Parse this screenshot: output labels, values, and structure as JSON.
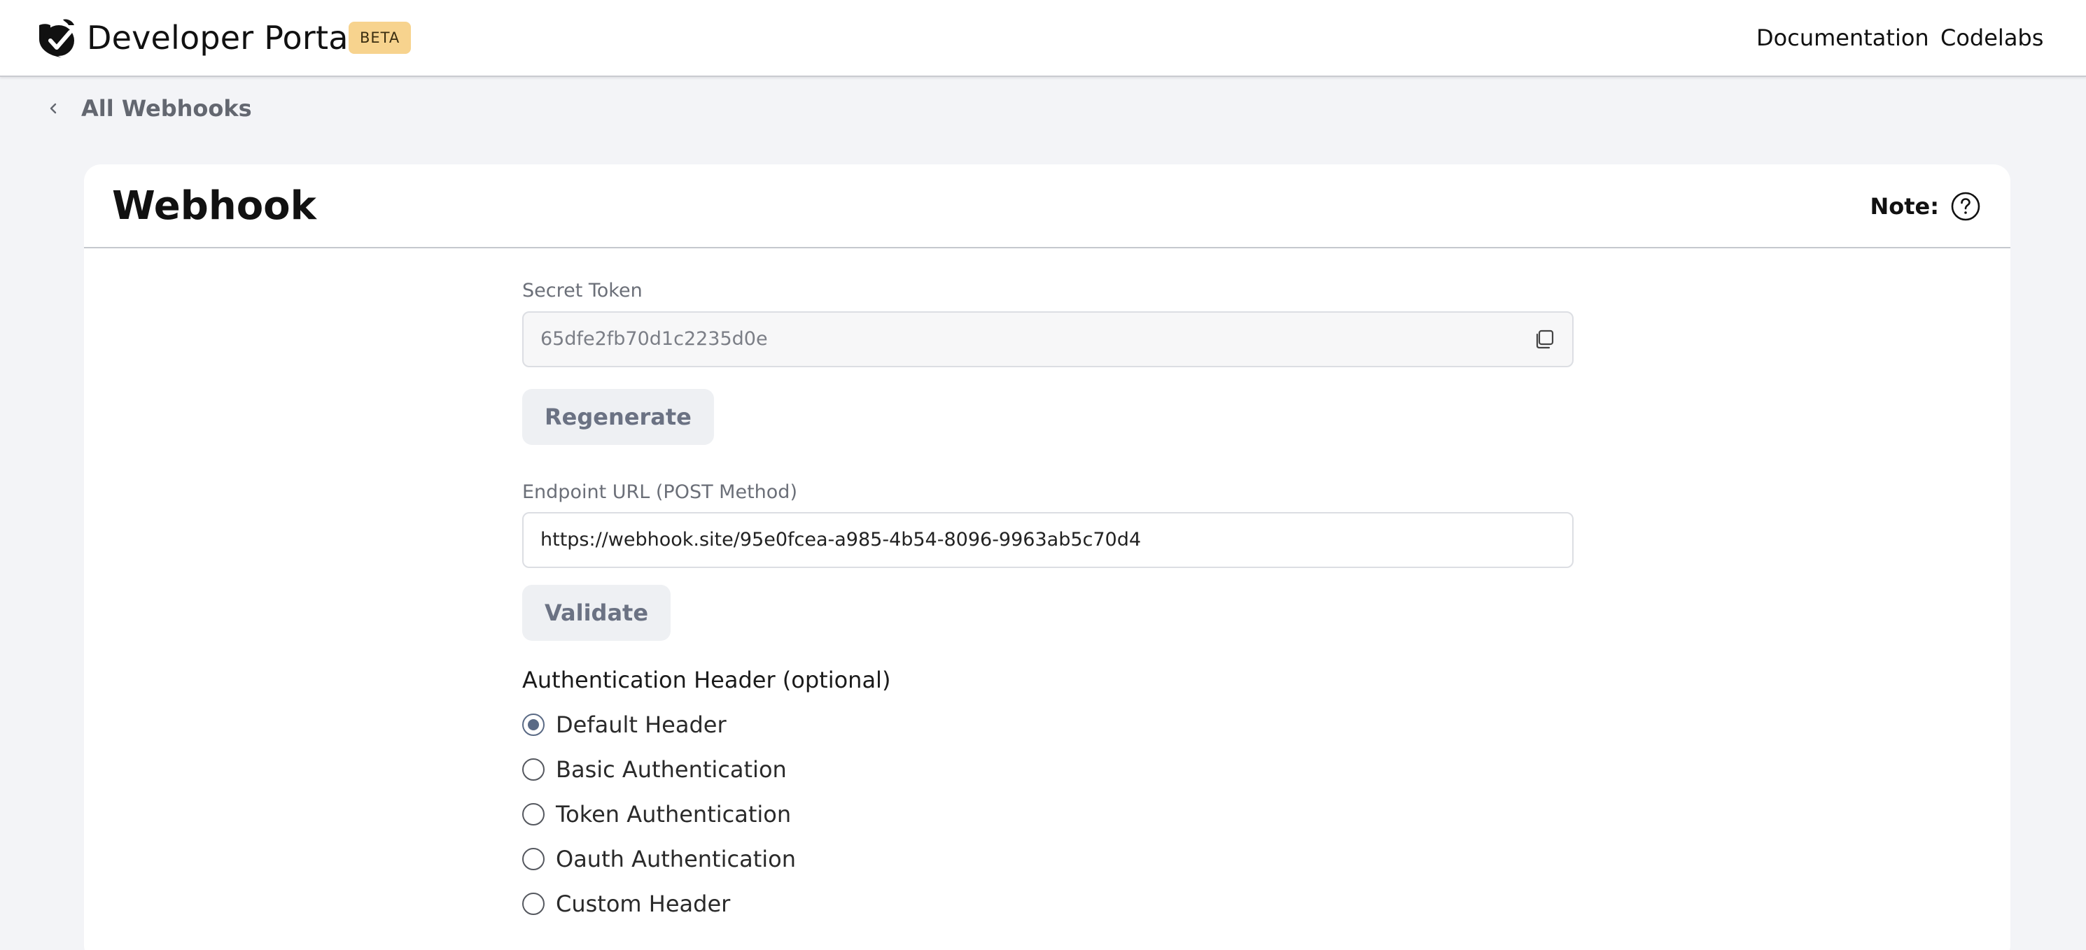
{
  "header": {
    "title": "Developer Portal",
    "badge": "BETA",
    "nav": [
      {
        "label": "Documentation"
      },
      {
        "label": "Codelabs"
      }
    ]
  },
  "breadcrumb": {
    "back_label": "All Webhooks"
  },
  "card": {
    "title": "Webhook",
    "note_label": "Note:"
  },
  "form": {
    "secret_token": {
      "label": "Secret Token",
      "value": "65dfe2fb70d1c2235d0e"
    },
    "regenerate_label": "Regenerate",
    "endpoint": {
      "label": "Endpoint URL (POST Method)",
      "value": "https://webhook.site/95e0fcea-a985-4b54-8096-9963ab5c70d4"
    },
    "validate_label": "Validate",
    "auth": {
      "heading": "Authentication Header (optional)",
      "options": [
        {
          "label": "Default Header",
          "checked": true
        },
        {
          "label": "Basic Authentication",
          "checked": false
        },
        {
          "label": "Token Authentication",
          "checked": false
        },
        {
          "label": "Oauth Authentication",
          "checked": false
        },
        {
          "label": "Custom Header",
          "checked": false
        }
      ]
    }
  },
  "icons": {
    "logo": "checkmark-shield-logo-icon",
    "back": "chevron-left-icon",
    "help": "question-circle-icon",
    "copy": "copy-icon"
  }
}
